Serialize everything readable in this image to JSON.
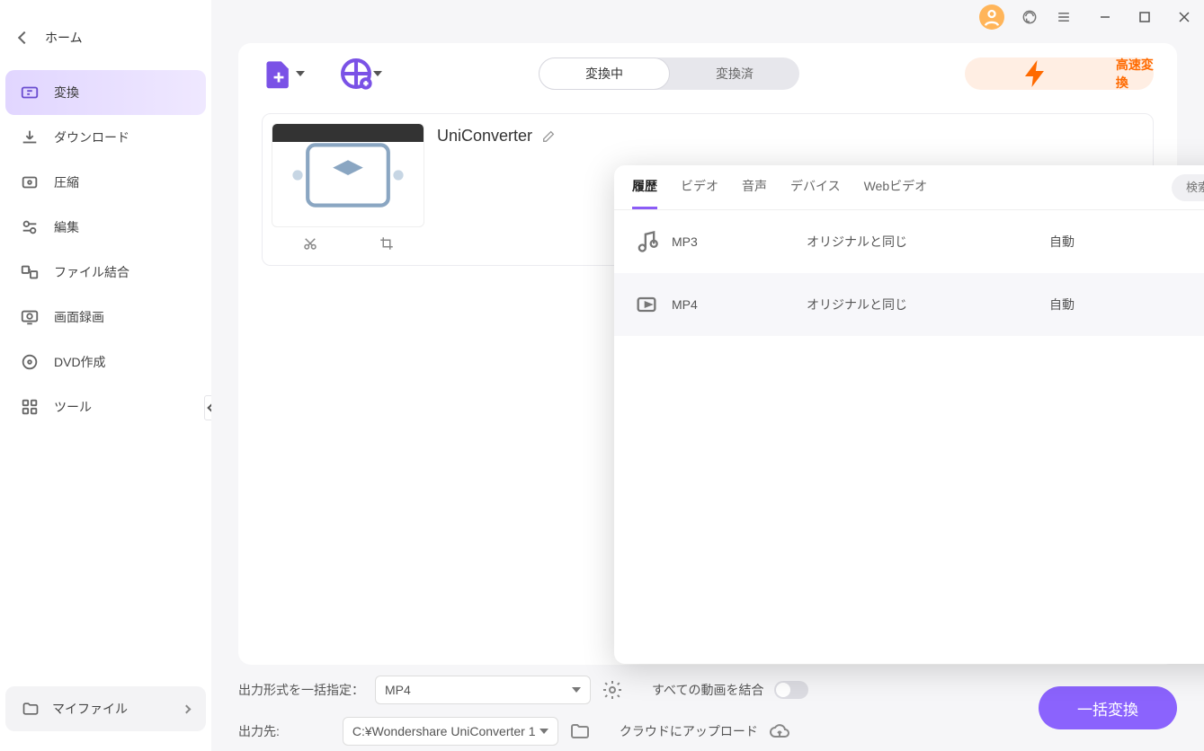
{
  "sidebar": {
    "home": "ホーム",
    "items": [
      {
        "label": "変換",
        "icon": "convert-icon"
      },
      {
        "label": "ダウンロード",
        "icon": "download-icon"
      },
      {
        "label": "圧縮",
        "icon": "compress-icon"
      },
      {
        "label": "編集",
        "icon": "edit-icon"
      },
      {
        "label": "ファイル結合",
        "icon": "merge-icon"
      },
      {
        "label": "画面録画",
        "icon": "record-icon"
      },
      {
        "label": "DVD作成",
        "icon": "dvd-icon"
      },
      {
        "label": "ツール",
        "icon": "tools-icon"
      }
    ],
    "myfile": "マイファイル"
  },
  "toolbar": {
    "segment": {
      "a": "変換中",
      "b": "変換済"
    },
    "fast": "高速変換"
  },
  "file": {
    "title": "UniConverter"
  },
  "format_panel": {
    "tabs": [
      "履歴",
      "ビデオ",
      "音声",
      "デバイス",
      "Webビデオ"
    ],
    "search_placeholder": "検索",
    "rows": [
      {
        "name": "MP3",
        "quality": "オリジナルと同じ",
        "auto": "自動",
        "icon": "music-note-icon"
      },
      {
        "name": "MP4",
        "quality": "オリジナルと同じ",
        "auto": "自動",
        "icon": "video-file-icon"
      }
    ]
  },
  "bottom": {
    "format_label": "出力形式を一括指定：",
    "format_value": "MP4",
    "dest_label": "出力先:",
    "dest_value": "C:¥Wondershare UniConverter 1",
    "merge_label": "すべての動画を結合",
    "cloud_label": "クラウドにアップロード",
    "cta": "一括変換"
  },
  "colors": {
    "accent": "#8b63fd",
    "warn": "#ff6a00"
  }
}
